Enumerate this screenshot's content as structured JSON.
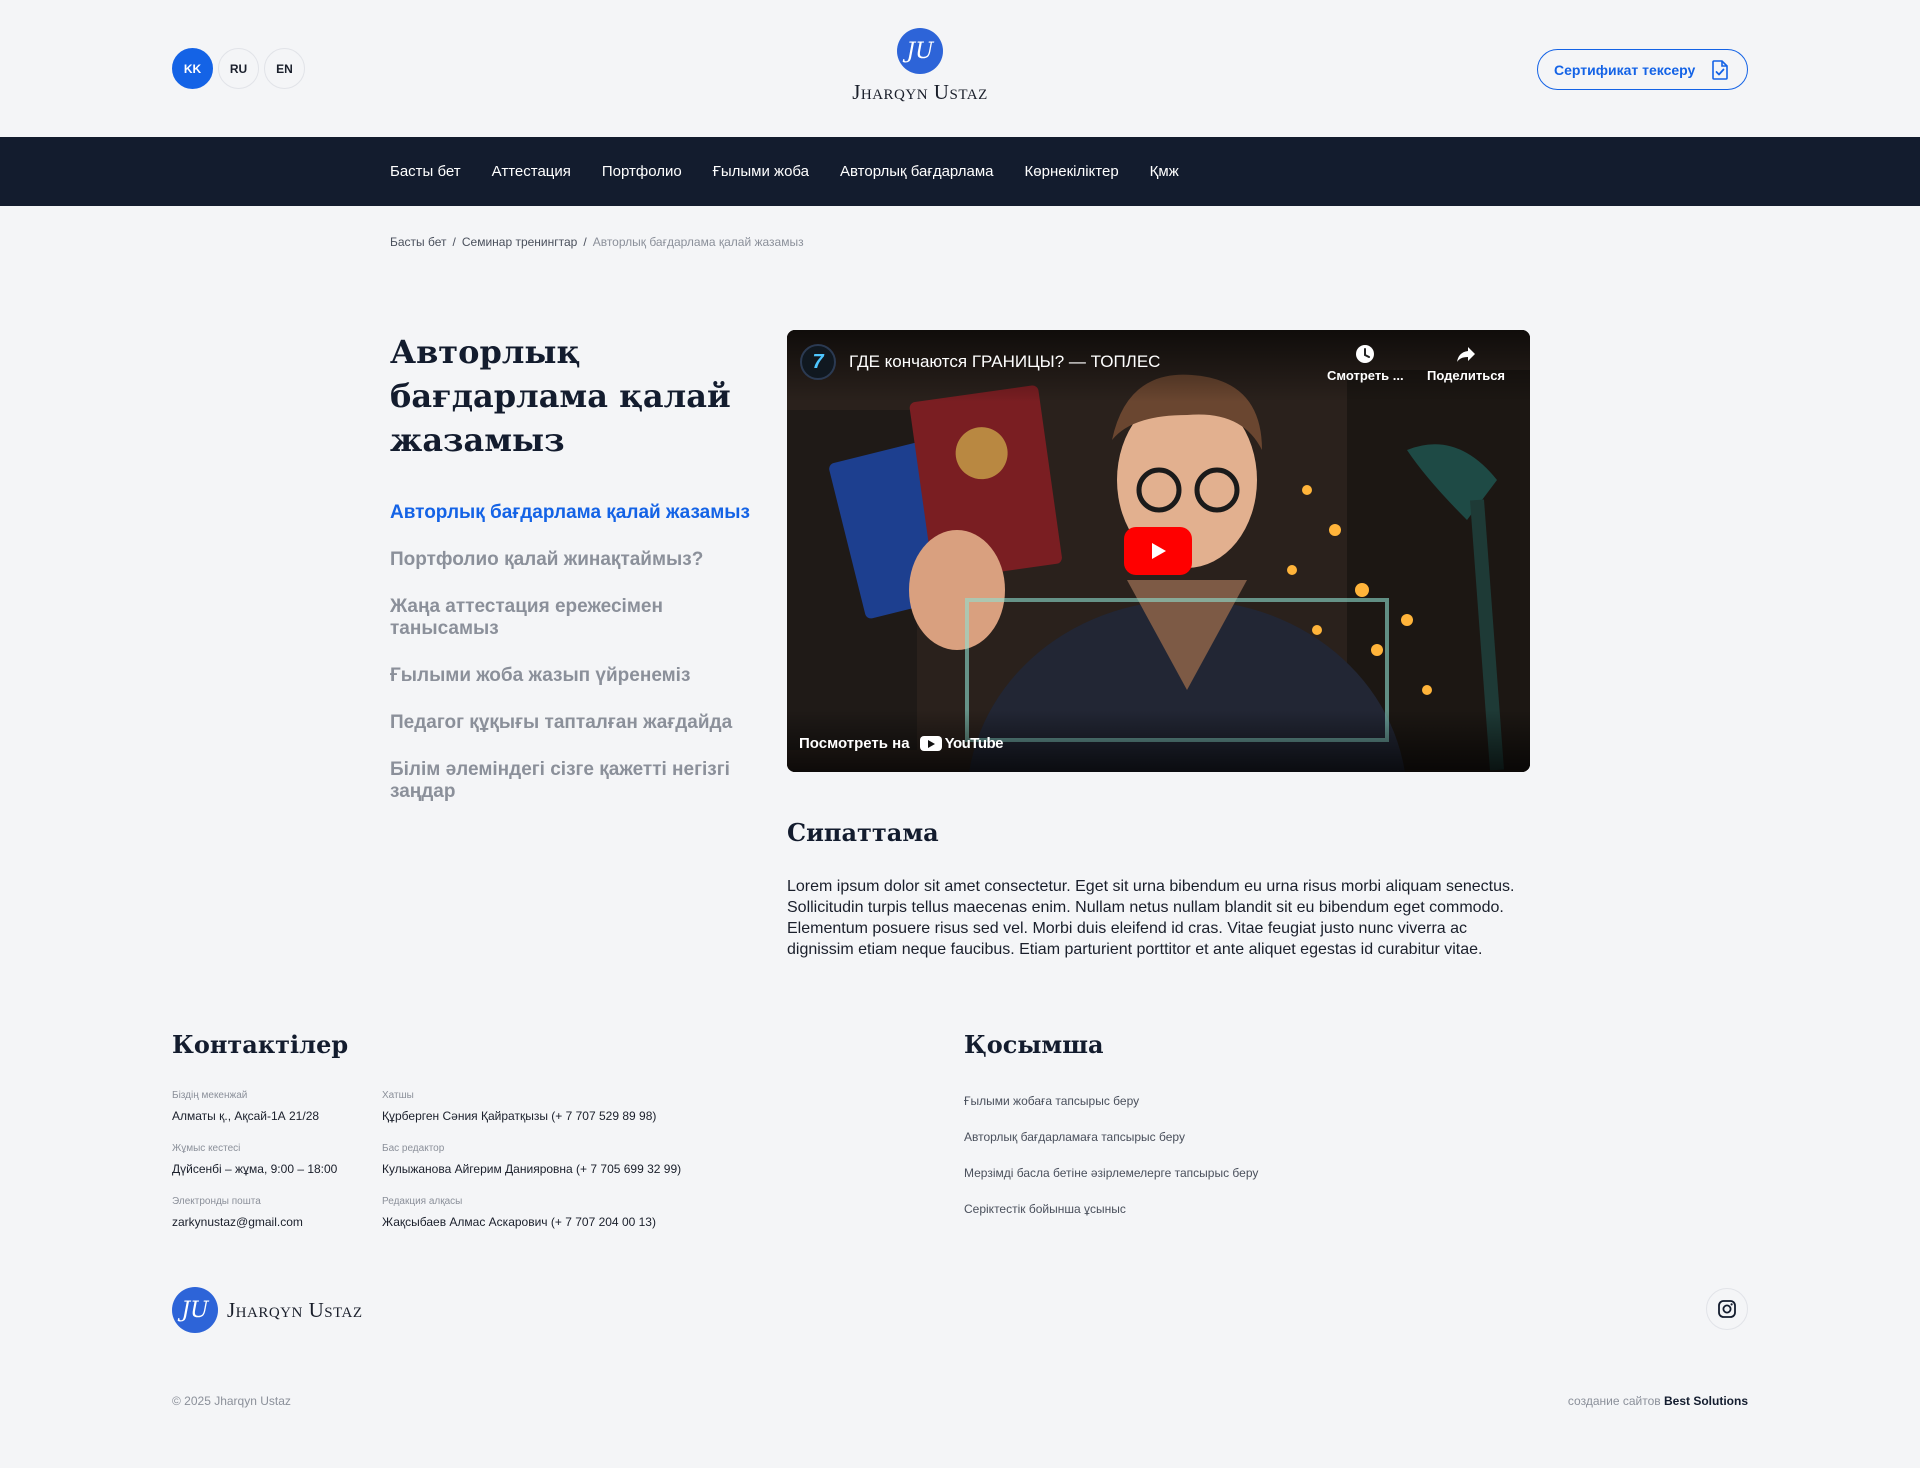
{
  "header": {
    "languages": [
      "KK",
      "RU",
      "EN"
    ],
    "active_language": "KK",
    "logo_text": "Jharqyn Ustaz",
    "logo_mark": "JU",
    "cert_button": "Сертификат тексеру"
  },
  "nav": {
    "items": [
      "Басты бет",
      "Аттестация",
      "Портфолио",
      "Ғылыми жоба",
      "Авторлық бағдарлама",
      "Көрнекіліктер",
      "Қмж"
    ]
  },
  "breadcrumb": {
    "items": [
      "Басты бет",
      "Семинар тренингтар"
    ],
    "separator": "/",
    "current": "Авторлық бағдарлама қалай жазамыз"
  },
  "page": {
    "title": "Авторлық бағдарлама қалай жазамыз",
    "side_menu": [
      "Авторлық бағдарлама қалай жазамыз",
      "Портфолио қалай жинақтаймыз?",
      "Жаңа аттестация ережесімен танысамыз",
      "Ғылыми жоба жазып үйренеміз",
      "Педагог құқығы тапталған жағдайда",
      "Білім әлеміндегі сізге қажетті негізгі заңдар"
    ]
  },
  "video": {
    "channel_initial": "7",
    "title": "ГДЕ кончаются ГРАНИЦЫ? — ТОПЛЕС",
    "watch_later": "Смотреть ...",
    "share": "Поделиться",
    "watch_on": "Посмотреть на",
    "youtube": "YouTube"
  },
  "description": {
    "title": "Сипаттама",
    "text": "Lorem ipsum dolor sit amet consectetur. Eget sit urna bibendum eu urna risus morbi aliquam senectus. Sollicitudin turpis tellus maecenas enim. Nullam netus nullam blandit sit eu bibendum eget commodo. Elementum posuere risus sed vel. Morbi duis eleifend id cras. Vitae feugiat justo nunc viverra ac dignissim etiam neque faucibus. Etiam parturient porttitor et ante aliquet egestas id curabitur vitae."
  },
  "footer": {
    "contacts_title": "Контактілер",
    "contacts": {
      "address_label": "Біздің мекенжай",
      "address": "Алматы қ., Ақсай-1А 21/28",
      "hours_label": "Жұмыс кестесі",
      "hours": "Дүйсенбі – жұма, 9:00 – 18:00",
      "email_label": "Электронды пошта",
      "email": "zarkynustaz@gmail.com",
      "secretary_label": "Хатшы",
      "secretary": "Құрберген Сәния Қайратқызы (+ 7 707 529 89 98)",
      "editor_label": "Бас редактор",
      "editor": "Кулыжанова Айгерим Данияровна (+ 7 705 699 32 99)",
      "board_label": "Редакция алқасы",
      "board": "Жақсыбаев Алмас Аскарович  (+ 7 707 204 00 13)"
    },
    "extra_title": "Қосымша",
    "extra_links": [
      "Ғылыми жобаға тапсырыс беру",
      "Авторлық бағдарламаға тапсырыс беру",
      "Мерзімді басла бетіне әзірлемелерге тапсырыс беру",
      "Серіктестік бойынша ұсыныс"
    ],
    "logo_text": "Jharqyn Ustaz",
    "copyright": "© 2025 Jharqyn Ustaz",
    "credit_prefix": "создание сайтов",
    "credit_brand": "Best Solutions"
  },
  "colors": {
    "accent": "#1463e6",
    "nav_bg": "#131c2e",
    "page_bg": "#f4f5f7",
    "muted": "#8b909a"
  }
}
